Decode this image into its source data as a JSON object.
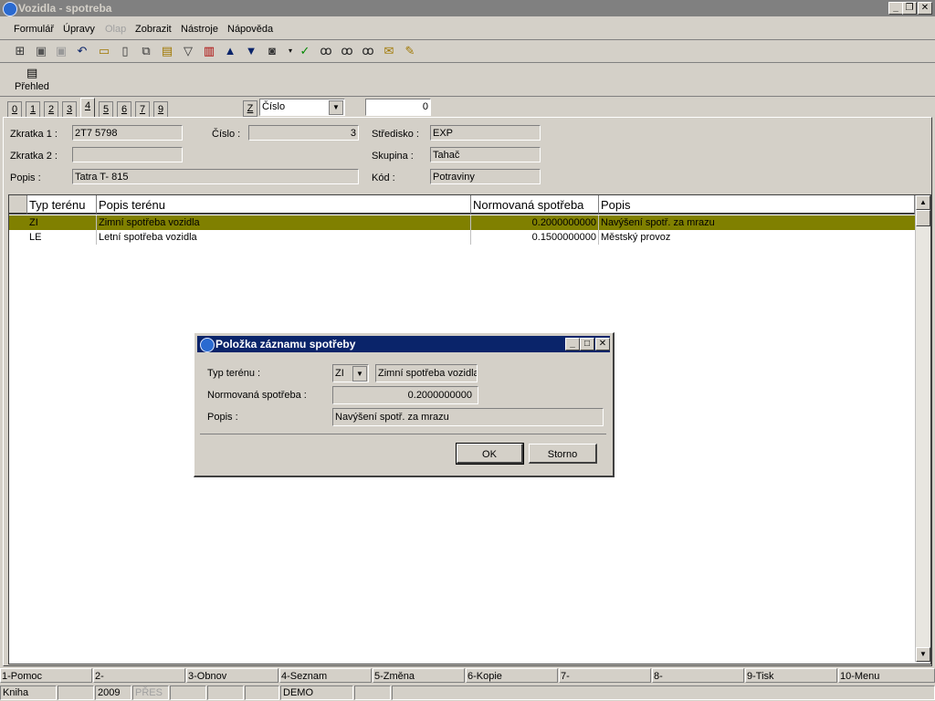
{
  "window": {
    "title": "Vozidla - spotreba"
  },
  "menu": [
    {
      "label": "Formulář"
    },
    {
      "label": "Úpravy"
    },
    {
      "label": "Olap",
      "disabled": true
    },
    {
      "label": "Zobrazit"
    },
    {
      "label": "Nástroje"
    },
    {
      "label": "Nápověda"
    }
  ],
  "toolbar_icons": [
    "tree-icon",
    "save-icon",
    "save-disabled-icon",
    "undo-icon",
    "open-folder-icon",
    "new-document-icon",
    "copy-icon",
    "book-icon",
    "filter-icon",
    "filter-list-icon",
    "arrow-up-icon",
    "arrow-down-icon",
    "camera-icon",
    "dropdown-arrow-icon",
    "person-check-icon",
    "binoculars-icon",
    "binoculars-2-icon",
    "binoculars-3-icon",
    "mail-icon",
    "notes-icon"
  ],
  "view": {
    "overview_label": "Přehled"
  },
  "tabs": [
    "0",
    "1",
    "2",
    "3",
    "4",
    "5",
    "6",
    "7",
    "9"
  ],
  "active_tab": "4",
  "sort": {
    "key_label": "Z",
    "field": "Číslo",
    "value": "0"
  },
  "form": {
    "zkratka1_label": "Zkratka 1 :",
    "zkratka1": "2T7 5798",
    "zkratka2_label": "Zkratka 2 :",
    "zkratka2": "",
    "popis_label": "Popis :",
    "popis": "Tatra T- 815",
    "cislo_label": "Číslo :",
    "cislo": "3",
    "stredisko_label": "Středisko :",
    "stredisko": "EXP",
    "skupina_label": "Skupina :",
    "skupina": "Tahač",
    "kod_label": "Kód :",
    "kod": "Potraviny"
  },
  "grid": {
    "columns": [
      "Typ terénu",
      "Popis terénu",
      "Normovaná spotřeba",
      "Popis"
    ],
    "rows": [
      {
        "typ": "ZI",
        "popis_terenu": "Zimní spotřeba vozidla",
        "spotreba": "0.2000000000",
        "popis": "Navýšení spotř. za mrazu",
        "selected": true
      },
      {
        "typ": "LE",
        "popis_terenu": "Letní spotřeba vozidla",
        "spotreba": "0.1500000000",
        "popis": "Městský provoz",
        "selected": false
      }
    ]
  },
  "dialog": {
    "title": "Položka záznamu spotřeby",
    "typ_label": "Typ terénu :",
    "typ_value": "ZI",
    "typ_desc": "Zimní spotřeba vozidla",
    "spotreba_label": "Normovaná spotřeba :",
    "spotreba_value": "0.2000000000",
    "popis_label": "Popis :",
    "popis_value": "Navýšení spotř. za mrazu",
    "ok_label": "OK",
    "cancel_label": "Storno"
  },
  "function_keys": [
    "1-Pomoc",
    "2-",
    "3-Obnov",
    "4-Seznam",
    "5-Změna",
    "6-Kopie",
    "7-",
    "8-",
    "9-Tisk",
    "10-Menu"
  ],
  "statusbar": {
    "mode": "Kniha",
    "year": "2009",
    "overwrite": "PŘES",
    "db": "DEMO"
  },
  "colors": {
    "selected_row": "#808000",
    "dialog_title": "#0a246a",
    "inactive_title": "#808080"
  }
}
